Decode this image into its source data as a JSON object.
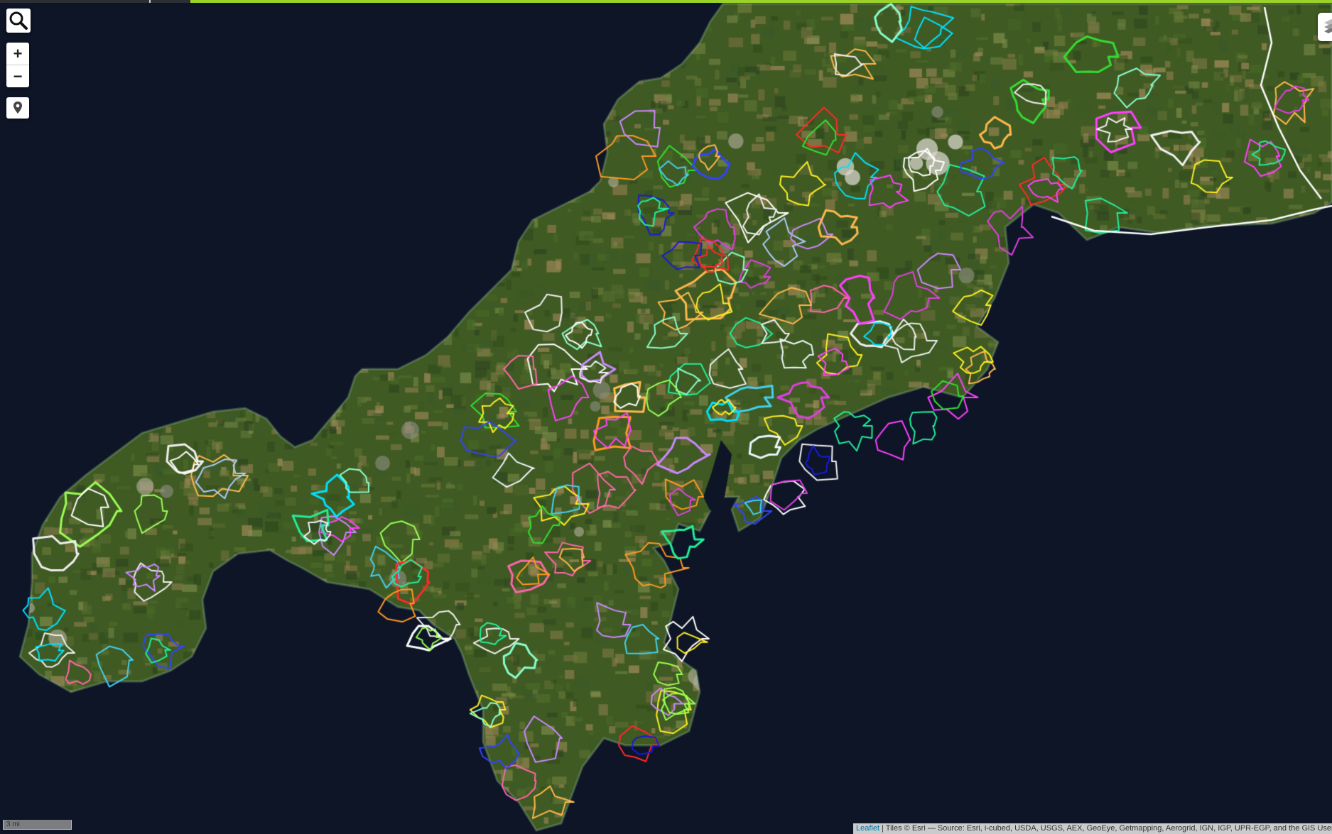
{
  "map": {
    "basemap": "satellite-imagery",
    "sea_color": "#0d1527",
    "land_color": "#3f5a22",
    "route_colors": [
      "#ffffff",
      "#f0f0f0",
      "#eef6ff",
      "#ff2a2a",
      "#ff40ff",
      "#e040e0",
      "#ffee22",
      "#33dd33",
      "#22ee99",
      "#00e0ff",
      "#44d0ee",
      "#1a1ad8",
      "#3344ff",
      "#ff9922",
      "#ffb84d",
      "#ff66aa",
      "#cc88ff",
      "#aaccff",
      "#99ff55",
      "#88ffcc"
    ]
  },
  "controls": {
    "search_icon": "search-icon",
    "zoom_in": "+",
    "zoom_out": "−",
    "locate_icon": "map-pin-icon",
    "layers_icon": "layers-icon"
  },
  "scale": {
    "label": "3 mi"
  },
  "attribution": {
    "link": "Leaflet",
    "text": " | Tiles © Esri — Source: Esri, i-cubed, USDA, USGS, AEX, GeoEye, Getmapping, Aerogrid, IGN, IGP, UPR-EGP, and the GIS User Community"
  }
}
